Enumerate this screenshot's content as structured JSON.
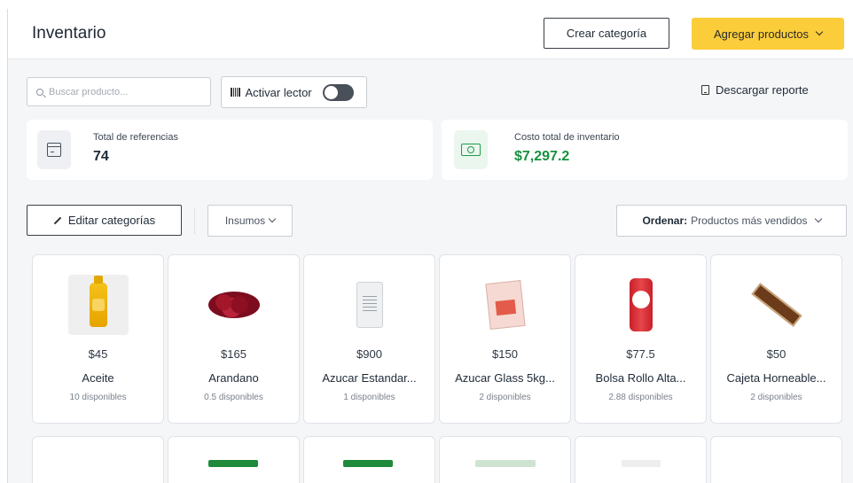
{
  "header": {
    "title": "Inventario",
    "crear_label": "Crear categoría",
    "agregar_label": "Agregar productos"
  },
  "toolbar": {
    "search_placeholder": "Buscar producto...",
    "lector_label": "Activar lector",
    "lector_enabled": false,
    "descargar_label": "Descargar reporte"
  },
  "stats": [
    {
      "label": "Total de referencias",
      "value": "74",
      "icon": "box-icon"
    },
    {
      "label": "Costo total de inventario",
      "value": "$7,297.2",
      "icon": "cash-icon",
      "color": "#17913f"
    }
  ],
  "filters": {
    "editar_label": "Editar categorías",
    "category_label": "Insumos",
    "ordenar_label": "Ordenar:",
    "ordenar_value": "Productos más vendidos"
  },
  "products": [
    {
      "price": "$45",
      "name": "Aceite",
      "stock": "10 disponibles"
    },
    {
      "price": "$165",
      "name": "Arandano",
      "stock": "0.5 disponibles"
    },
    {
      "price": "$900",
      "name": "Azucar Estandar...",
      "stock": "1 disponibles"
    },
    {
      "price": "$150",
      "name": "Azucar Glass 5kg...",
      "stock": "2 disponibles"
    },
    {
      "price": "$77.5",
      "name": "Bolsa Rollo Alta...",
      "stock": "2.88 disponibles"
    },
    {
      "price": "$50",
      "name": "Cajeta Horneable...",
      "stock": "2 disponibles"
    }
  ],
  "colors": {
    "accent_yellow": "#fbcd3a",
    "success_green": "#17913f"
  }
}
